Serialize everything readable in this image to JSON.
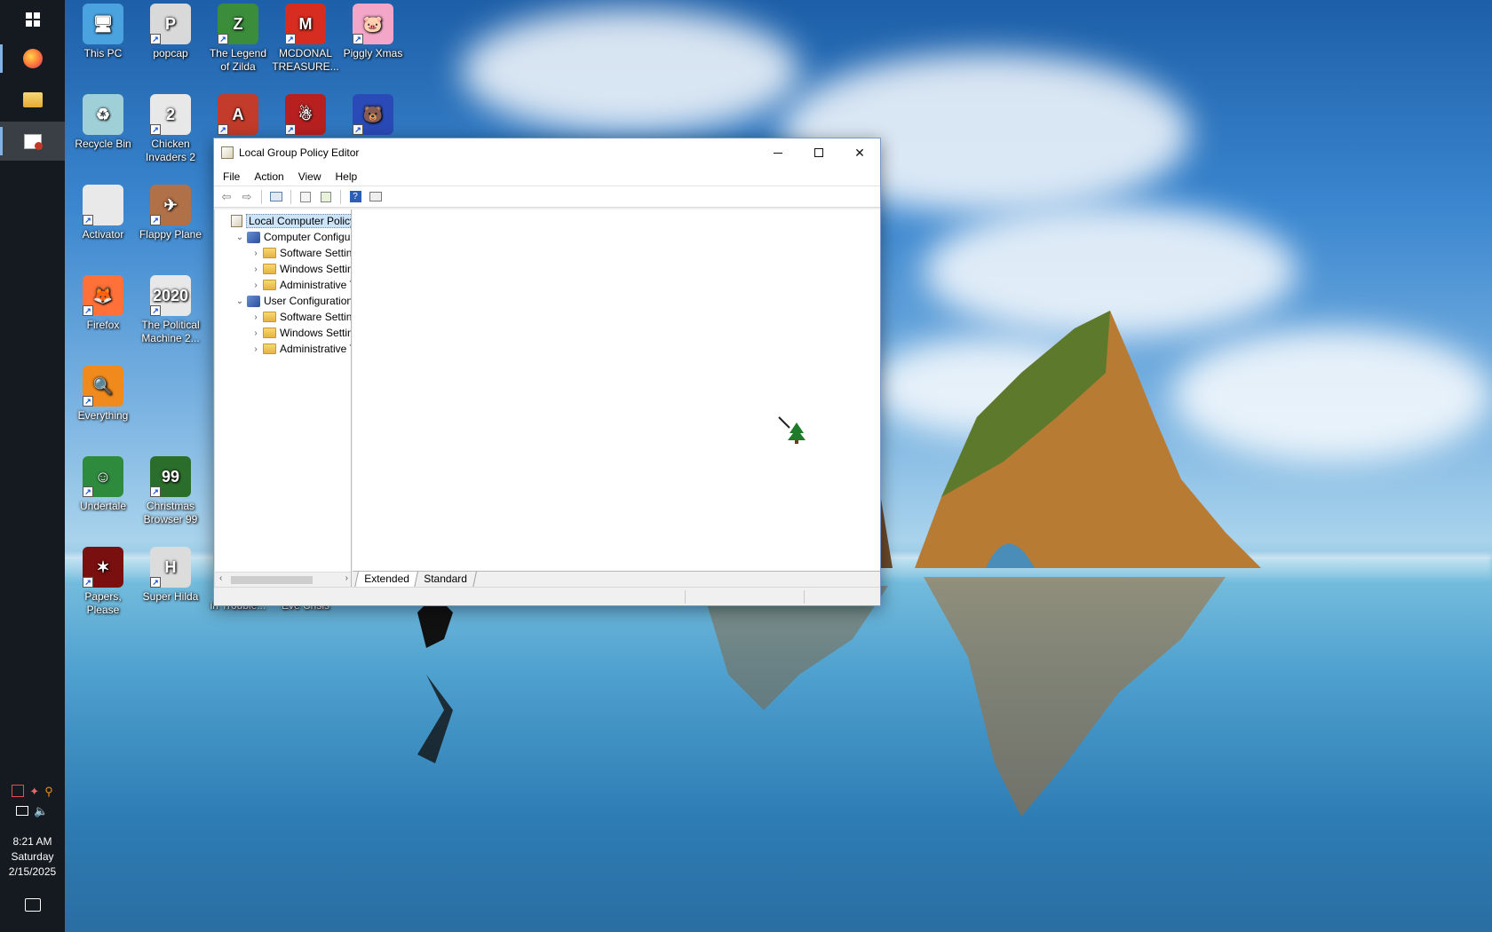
{
  "window": {
    "title": "Local Group Policy Editor",
    "menu": [
      "File",
      "Action",
      "View",
      "Help"
    ],
    "tree": [
      {
        "label": "Local Computer Policy",
        "level": 0,
        "expanded": null,
        "selected": true
      },
      {
        "label": "Computer Configuration",
        "level": 1,
        "expanded": true
      },
      {
        "label": "Software Settings",
        "level": 2,
        "expanded": false
      },
      {
        "label": "Windows Settings",
        "level": 2,
        "expanded": false
      },
      {
        "label": "Administrative Templates",
        "level": 2,
        "expanded": false
      },
      {
        "label": "User Configuration",
        "level": 1,
        "expanded": true
      },
      {
        "label": "Software Settings",
        "level": 2,
        "expanded": false
      },
      {
        "label": "Windows Settings",
        "level": 2,
        "expanded": false
      },
      {
        "label": "Administrative Templates",
        "level": 2,
        "expanded": false
      }
    ],
    "tabs": [
      "Extended",
      "Standard"
    ],
    "active_tab": "Extended"
  },
  "desktop_icons": [
    {
      "label": "This PC",
      "color": "#4aa3df",
      "glyph": "🖥"
    },
    {
      "label": "popcap",
      "color": "#d9d9d9",
      "glyph": "P"
    },
    {
      "label": "The Legend of Zilda",
      "color": "#3b8d3b",
      "glyph": "Z"
    },
    {
      "label": "MCDONAL TREASURE...",
      "color": "#d62d20",
      "glyph": "M"
    },
    {
      "label": "Piggly Xmas",
      "color": "#f3a6c8",
      "glyph": "🐷"
    },
    {
      "label": "Recycle Bin",
      "color": "#9fd0d8",
      "glyph": "♻"
    },
    {
      "label": "Chicken Invaders 2",
      "color": "#e8e8e8",
      "glyph": "2"
    },
    {
      "label": "",
      "color": "#c33b2a",
      "glyph": "A"
    },
    {
      "label": "",
      "color": "#b82020",
      "glyph": "☃"
    },
    {
      "label": "",
      "color": "#2a4ab8",
      "glyph": "🐻"
    },
    {
      "label": "Activator",
      "color": "#e9e9e9",
      "glyph": ""
    },
    {
      "label": "Flappy Plane",
      "color": "#b07048",
      "glyph": "✈"
    },
    {
      "label": "Firefox",
      "color": "#ff7139",
      "glyph": "🦊"
    },
    {
      "label": "The Political Machine 2...",
      "color": "#e8e8e8",
      "glyph": "2020"
    },
    {
      "label": "Everything",
      "color": "#f08a1c",
      "glyph": "🔍"
    },
    {
      "label": "Undertale",
      "color": "#2e8b3e",
      "glyph": "☺"
    },
    {
      "label": "Christmas Browser 99",
      "color": "#2b6e2b",
      "glyph": "99"
    },
    {
      "label": "Papers, Please",
      "color": "#7a0f0f",
      "glyph": "✶"
    },
    {
      "label": "Super Hilda",
      "color": "#dcdcdc",
      "glyph": "H"
    },
    {
      "label": "in Trouble...",
      "color": "",
      "glyph": ""
    },
    {
      "label": "Eve Crisis",
      "color": "",
      "glyph": ""
    }
  ],
  "taskbar": {
    "clock_time": "8:21 AM",
    "clock_day": "Saturday",
    "clock_date": "2/15/2025"
  }
}
